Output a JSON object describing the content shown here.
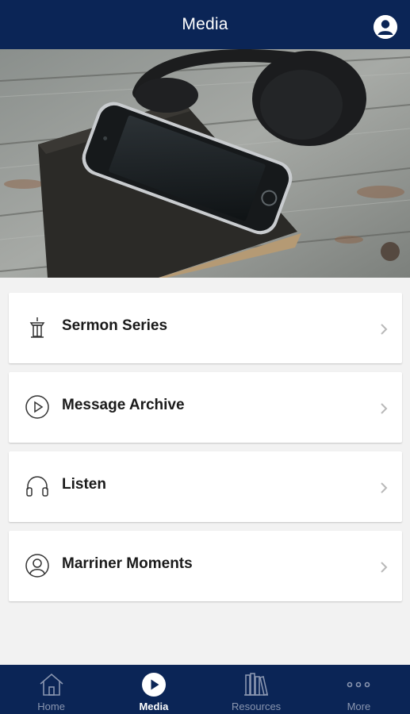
{
  "header": {
    "title": "Media",
    "profile_icon": "user-profile-icon"
  },
  "hero": {
    "alt_subject": "headphones-phone-bible-photo"
  },
  "menu": {
    "items": [
      {
        "label": "Sermon Series",
        "icon": "pulpit-icon"
      },
      {
        "label": "Message Archive",
        "icon": "play-circle-icon"
      },
      {
        "label": "Listen",
        "icon": "headphones-icon"
      },
      {
        "label": "Marriner Moments",
        "icon": "person-circle-icon"
      }
    ],
    "chevron_icon": "chevron-right-icon"
  },
  "tabbar": {
    "tabs": [
      {
        "label": "Home",
        "icon": "home-icon",
        "active": false
      },
      {
        "label": "Media",
        "icon": "play-circle-icon",
        "active": true
      },
      {
        "label": "Resources",
        "icon": "books-icon",
        "active": false
      },
      {
        "label": "More",
        "icon": "more-dots-icon",
        "active": false
      }
    ]
  },
  "colors": {
    "header_bg": "#0b2556",
    "page_bg": "#f2f2f2",
    "card_bg": "#ffffff",
    "inactive_tab": "#8a96b0",
    "active_tab": "#ffffff"
  }
}
